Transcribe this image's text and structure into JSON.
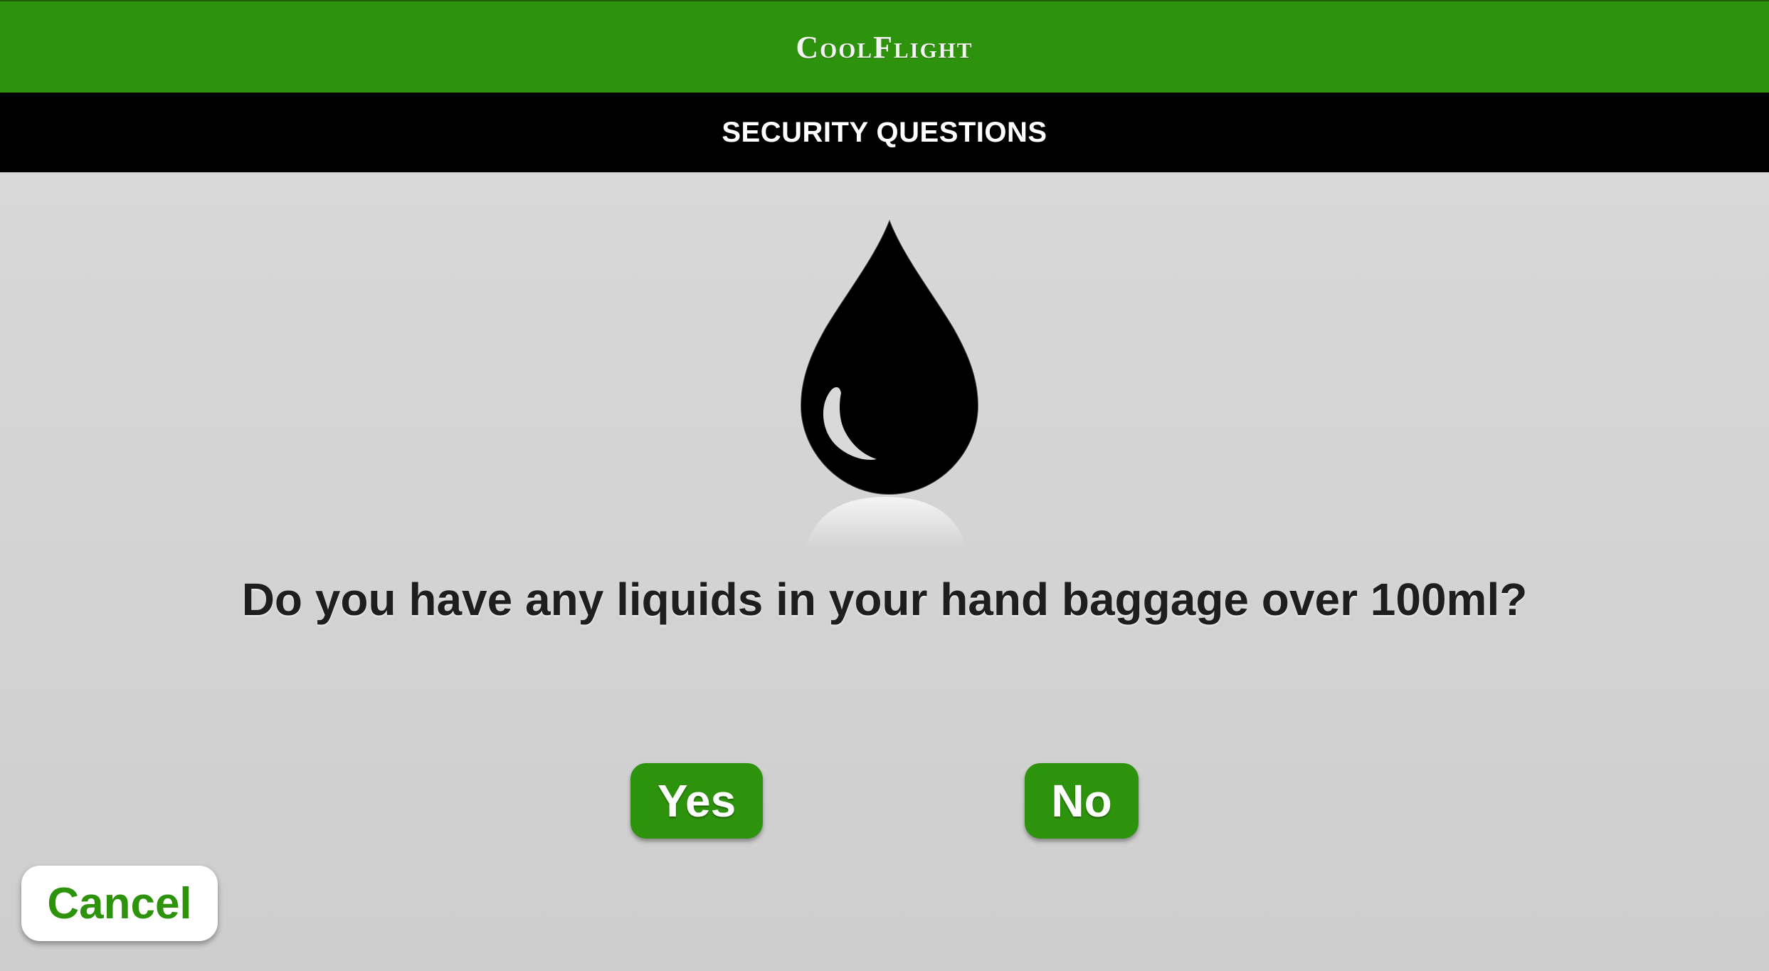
{
  "header": {
    "app_title": "CoolFlight",
    "brand_color": "#2e930c"
  },
  "section": {
    "title": "SECURITY QUESTIONS"
  },
  "question": {
    "icon": "water-drop-icon",
    "text": "Do you have any liquids in your hand baggage over 100ml?"
  },
  "answers": {
    "yes_label": "Yes",
    "no_label": "No"
  },
  "footer": {
    "cancel_label": "Cancel"
  }
}
